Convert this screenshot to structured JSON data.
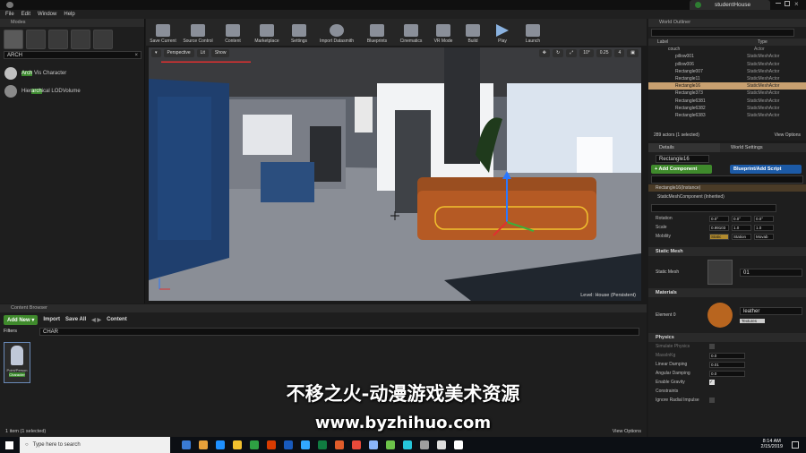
{
  "window": {
    "app_title": "studentHouse"
  },
  "menu": [
    "File",
    "Edit",
    "Window",
    "Help"
  ],
  "modes": {
    "tab": "Modes",
    "search_value": "ARCH",
    "items": [
      {
        "prefix": "",
        "highlight": "Arch",
        "suffix": " Vis Character"
      },
      {
        "prefix": "Hier",
        "highlight": "arch",
        "suffix": "ical LODVolume"
      }
    ]
  },
  "toolbar": [
    "Save Current",
    "Source Control",
    "Content",
    "Marketplace",
    "Settings",
    "Import Datasmith",
    "Blueprints",
    "Cinematics",
    "VR Mode",
    "Build",
    "Play",
    "Launch"
  ],
  "viewport": {
    "perspective": "Perspective",
    "lit": "Lit",
    "show": "Show",
    "snap_angle": "10°",
    "scale": "0.25",
    "camera_speed": "4",
    "level_label": "Level: House (Persistent)"
  },
  "outliner": {
    "tab": "World Outliner",
    "col_label": "Label",
    "col_type": "Type",
    "rows": [
      {
        "label": "couch",
        "type": "Actor"
      },
      {
        "label": "pillow001",
        "type": "StaticMeshActor"
      },
      {
        "label": "pillow006",
        "type": "StaticMeshActor"
      },
      {
        "label": "Rectangle007",
        "type": "StaticMeshActor"
      },
      {
        "label": "Rectangle11",
        "type": "StaticMeshActor"
      },
      {
        "label": "Rectangle16",
        "type": "StaticMeshActor"
      },
      {
        "label": "Rectangle373",
        "type": "StaticMeshActor"
      },
      {
        "label": "Rectangle6381",
        "type": "StaticMeshActor"
      },
      {
        "label": "Rectangle6382",
        "type": "StaticMeshActor"
      },
      {
        "label": "Rectangle6383",
        "type": "StaticMeshActor"
      }
    ],
    "status": "289 actors (1 selected)",
    "view_options": "View Options"
  },
  "details": {
    "tab_details": "Details",
    "tab_world": "World Settings",
    "name_value": "Rectangle16",
    "add_component": "+ Add Component",
    "blueprint_script": "Blueprint/Add Script",
    "instance": "Rectangle16(Instance)",
    "inherited": "StaticMeshComponent (Inherited)",
    "rotation_label": "Rotation",
    "rotation": [
      "0.0°",
      "0.0°",
      "0.0°"
    ],
    "scale_label": "Scale",
    "scale": [
      "0.99103",
      "1.0",
      "1.0"
    ],
    "mobility_label": "Mobility",
    "mobility": [
      "Static",
      "Station",
      "Movab"
    ],
    "static_mesh_section": "Static Mesh",
    "static_mesh_label": "Static Mesh",
    "static_mesh_value": "01",
    "materials_section": "Materials",
    "element0": "Element 0",
    "material_value": "leather",
    "textures": "Textures",
    "physics_section": "Physics",
    "physics": [
      {
        "label": "Simulate Physics",
        "value": ""
      },
      {
        "label": "MassInKg",
        "value": "0.0"
      },
      {
        "label": "Linear Damping",
        "value": "0.01"
      },
      {
        "label": "Angular Damping",
        "value": "0.0"
      },
      {
        "label": "Enable Gravity",
        "value": ""
      },
      {
        "label": "Constraints",
        "value": ""
      },
      {
        "label": "Ignore Radial Impulse",
        "value": ""
      }
    ]
  },
  "content_browser": {
    "tab": "Content Browser",
    "add_new": "Add New",
    "import": "Import",
    "save_all": "Save All",
    "path": "Content",
    "filters": "Filters",
    "search_value": "CHAR",
    "asset_name_a": "Point/Person",
    "asset_name_b": "Character",
    "status": "1 item (1 selected)",
    "view_options": "View Options"
  },
  "taskbar": {
    "search_placeholder": "Type here to search",
    "time": "8:14 AM",
    "date": "2/15/2019",
    "icon_colors": [
      "#3a7bd5",
      "#e8a13a",
      "#1e90ff",
      "#f2c12e",
      "#2ea043",
      "#d83b01",
      "#185abd",
      "#31a8ff",
      "#107c41",
      "#e05c2a",
      "#e84a3a",
      "#8ab4f8",
      "#6cc24a",
      "#26c6da",
      "#9e9e9e",
      "#dddddd",
      "#ffffff"
    ]
  },
  "watermark": {
    "line1": "不移之火-动漫游戏美术资源",
    "line2": "www.byzhihuo.com"
  }
}
